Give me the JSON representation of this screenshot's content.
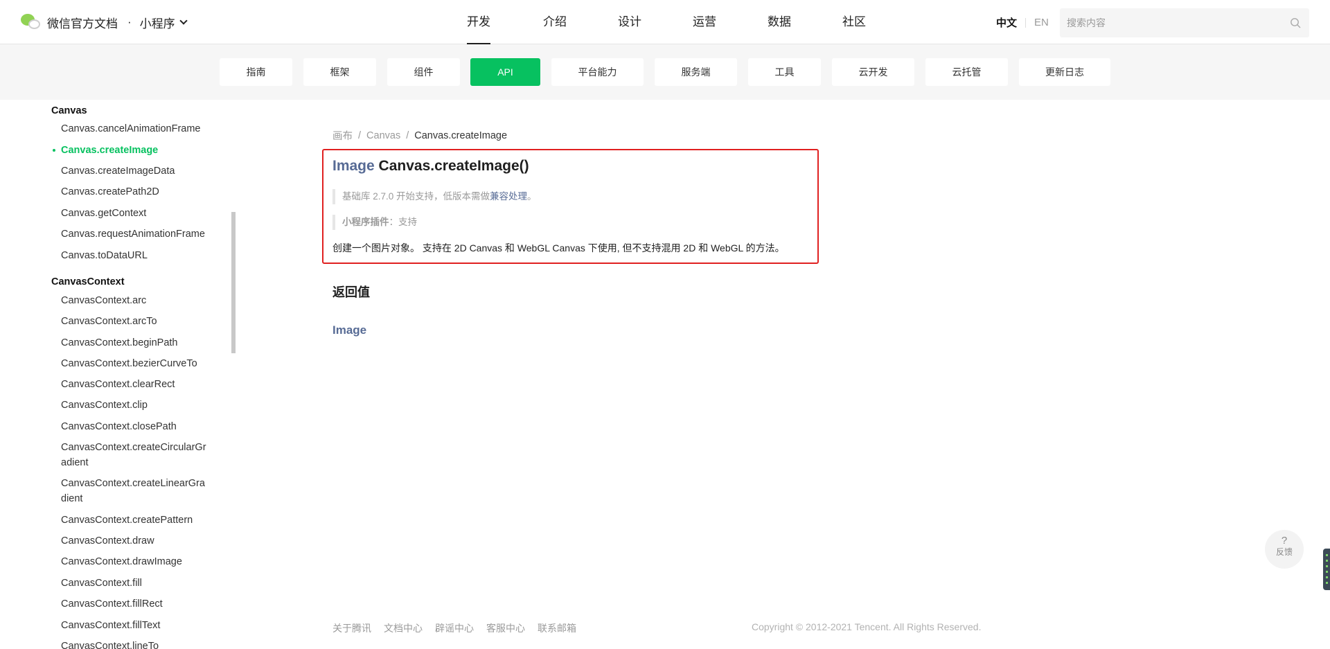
{
  "header": {
    "brand_title": "微信官方文档",
    "brand_dot": "·",
    "brand_product": "小程序",
    "nav": [
      "开发",
      "介绍",
      "设计",
      "运营",
      "数据",
      "社区"
    ],
    "nav_active": "开发",
    "lang_zh": "中文",
    "lang_en": "EN",
    "search_placeholder": "搜索内容"
  },
  "subnav": {
    "tabs": [
      "指南",
      "框架",
      "组件",
      "API",
      "平台能力",
      "服务端",
      "工具",
      "云开发",
      "云托管",
      "更新日志"
    ],
    "active": "API"
  },
  "sidebar": {
    "groups": [
      {
        "title": "Canvas",
        "items": [
          "Canvas.cancelAnimationFrame",
          "Canvas.createImage",
          "Canvas.createImageData",
          "Canvas.createPath2D",
          "Canvas.getContext",
          "Canvas.requestAnimationFrame",
          "Canvas.toDataURL"
        ]
      },
      {
        "title": "CanvasContext",
        "items": [
          "CanvasContext.arc",
          "CanvasContext.arcTo",
          "CanvasContext.beginPath",
          "CanvasContext.bezierCurveTo",
          "CanvasContext.clearRect",
          "CanvasContext.clip",
          "CanvasContext.closePath",
          "CanvasContext.createCircularGr",
          "adient",
          "CanvasContext.createLinearGra",
          "dient",
          "CanvasContext.createPattern",
          "CanvasContext.draw",
          "CanvasContext.drawImage",
          "CanvasContext.fill",
          "CanvasContext.fillRect",
          "CanvasContext.fillText",
          "CanvasContext.lineTo"
        ]
      }
    ],
    "active_item": "Canvas.createImage"
  },
  "breadcrumb": [
    "画布",
    "Canvas",
    "Canvas.createImage"
  ],
  "api": {
    "return_type": "Image",
    "signature": "Canvas.createImage()",
    "base_lib_prefix": "基础库 2.7.0 开始支持，低版本需做",
    "base_lib_link": "兼容处理",
    "base_lib_suffix": "。",
    "plugin_label": "小程序插件",
    "plugin_value": "：支持",
    "description": "创建一个图片对象。 支持在 2D Canvas 和 WebGL Canvas 下使用, 但不支持混用 2D 和 WebGL 的方法。"
  },
  "returns": {
    "heading": "返回值",
    "type_link": "Image"
  },
  "footer": {
    "links": [
      "关于腾讯",
      "文档中心",
      "辟谣中心",
      "客服中心",
      "联系邮箱"
    ],
    "copyright": "Copyright © 2012-2021 Tencent. All Rights Reserved."
  },
  "feedback": {
    "symbol": "?",
    "label": "反馈"
  },
  "colors": {
    "accent_green": "#07c160",
    "link_blue": "#576b95",
    "highlight_red": "#e02020"
  }
}
